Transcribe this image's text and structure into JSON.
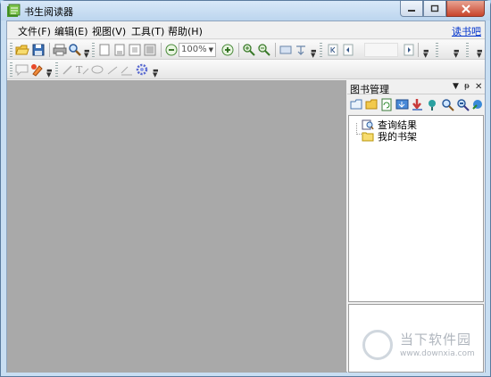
{
  "window": {
    "title": "书生阅读器",
    "minimize_icon": "minimize-icon",
    "maximize_icon": "maximize-icon",
    "close_icon": "close-icon"
  },
  "menu": {
    "items": [
      "文件(F)",
      "编辑(E)",
      "视图(V)",
      "工具(T)",
      "帮助(H)"
    ],
    "help_link": "读书吧"
  },
  "toolbar": {
    "zoom_value": "100%",
    "icons": [
      "open-folder-icon",
      "save-icon",
      "print-icon",
      "search-icon",
      "page-single-icon",
      "page-continuous-icon",
      "page-facing-icon",
      "page-thumbnail-icon",
      "zoom-out-icon",
      "zoom-in-icon",
      "magnify-plus-icon",
      "magnify-minus-icon",
      "fit-page-icon",
      "fit-width-icon",
      "first-page-icon",
      "prev-page-icon",
      "next-page-icon"
    ]
  },
  "annotation_toolbar": {
    "icons": [
      "note-icon",
      "highlight-pen-icon",
      "pencil-icon",
      "text-tool-icon",
      "ellipse-icon",
      "line-tool-icon",
      "underline-icon",
      "gear-icon"
    ]
  },
  "panel": {
    "title": "图书管理",
    "tools": [
      "new-library-icon",
      "open-folder-icon",
      "refresh-icon",
      "download-icon",
      "import-icon",
      "bookmark-icon",
      "find-icon",
      "advanced-search-icon",
      "export-icon"
    ],
    "tree": [
      {
        "label": "查询结果",
        "icon": "search-result-icon"
      },
      {
        "label": "我的书架",
        "icon": "folder-icon"
      }
    ]
  },
  "watermark": {
    "text": "当下软件园",
    "url": "www.downxia.com"
  },
  "colors": {
    "viewer_bg": "#a9a9a9",
    "link": "#0033cc",
    "frame": "#c8def2"
  }
}
